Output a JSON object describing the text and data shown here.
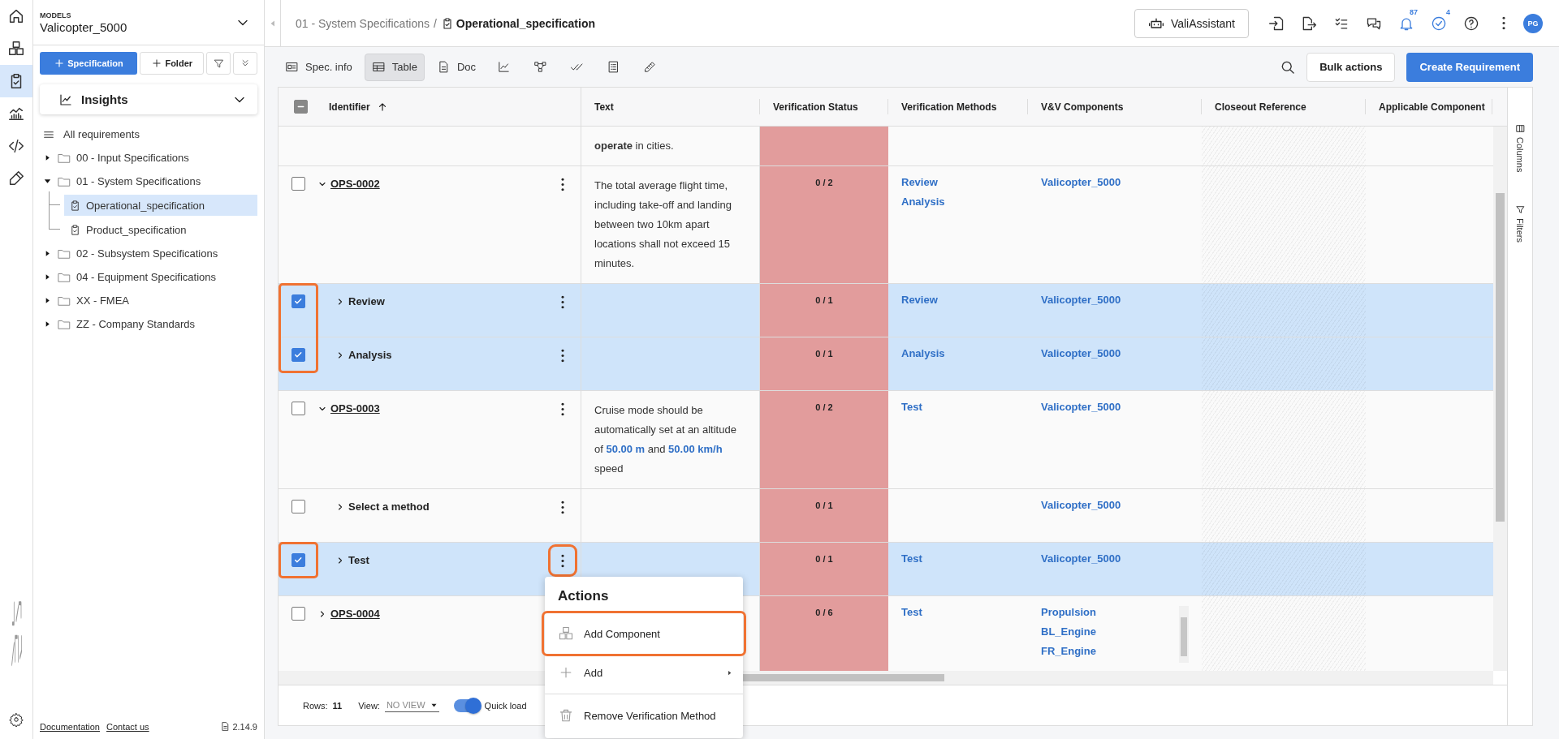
{
  "rail": {
    "items": [
      {
        "selected": false
      },
      {
        "selected": false
      },
      {
        "selected": true
      },
      {
        "selected": false
      },
      {
        "selected": false
      },
      {
        "selected": false
      }
    ]
  },
  "sidebar": {
    "models_label": "MODELS",
    "model": "Valicopter_5000",
    "spec_button": "Specification",
    "folder_button": "Folder",
    "insights": "Insights",
    "tree": {
      "all_label": "All requirements",
      "items": [
        {
          "kind": "folder",
          "label": "00 - Input Specifications",
          "expanded": false
        },
        {
          "kind": "folder",
          "label": "01 - System Specifications",
          "expanded": true,
          "children": [
            {
              "kind": "spec",
              "label": "Operational_specification",
              "selected": true
            },
            {
              "kind": "spec",
              "label": "Product_specification",
              "selected": false
            }
          ]
        },
        {
          "kind": "folder",
          "label": "02 - Subsystem Specifications",
          "expanded": false
        },
        {
          "kind": "folder",
          "label": "04 - Equipment Specifications",
          "expanded": false
        },
        {
          "kind": "folder",
          "label": "XX - FMEA",
          "expanded": false
        },
        {
          "kind": "folder",
          "label": "ZZ - Company Standards",
          "expanded": false
        }
      ]
    },
    "links": [
      "Documentation",
      "Contact us"
    ],
    "version": "2.14.9"
  },
  "header": {
    "breadcrumb_parent": "01 - System Specifications",
    "separator": "/",
    "breadcrumb_current": "Operational_specification",
    "assistant": "ValiAssistant",
    "notifications_badge": "87",
    "tasks_badge": "4",
    "avatar": "PG"
  },
  "toolbar": {
    "tabs": [
      {
        "label": "Spec. info",
        "selected": false
      },
      {
        "label": "Table",
        "selected": true
      },
      {
        "label": "Doc",
        "selected": false
      },
      {
        "selected": false
      },
      {
        "selected": false
      },
      {
        "selected": false
      },
      {
        "selected": false
      },
      {
        "selected": false
      }
    ],
    "bulk": "Bulk actions",
    "create": "Create Requirement"
  },
  "table": {
    "indeterminate": true,
    "columns": [
      {
        "label": "Identifier",
        "sorted_ascending": true
      },
      {
        "label": "Text"
      },
      {
        "label": "Verification Status"
      },
      {
        "label": "Verification Methods"
      },
      {
        "label": "V&V Components"
      },
      {
        "label": "Closeout Reference",
        "readonly": true
      },
      {
        "label": "Applicable Component"
      }
    ],
    "rows": [
      {
        "kind": "continuation",
        "text": [
          {
            "kind": "bold",
            "text": "operate"
          },
          {
            "kind": "plain",
            "text": " in cities."
          }
        ]
      },
      {
        "kind": "requirement",
        "identifier": "OPS-0002",
        "expanded": true,
        "checked": false,
        "text": [
          {
            "kind": "plain",
            "text": "The total average flight time, including take-off and landing between two 10km apart locations shall not exceed 15 minutes."
          }
        ],
        "status": "0 / 2",
        "methods": [
          "Review",
          "Analysis"
        ],
        "components": [
          "Valicopter_5000"
        ]
      },
      {
        "kind": "method",
        "identifier": "Review",
        "expanded": false,
        "checked": true,
        "highlighted": true,
        "status": "0 / 1",
        "methods": [
          "Review"
        ],
        "components": [
          "Valicopter_5000"
        ]
      },
      {
        "kind": "method",
        "identifier": "Analysis",
        "expanded": false,
        "checked": true,
        "highlighted": true,
        "status": "0 / 1",
        "methods": [
          "Analysis"
        ],
        "components": [
          "Valicopter_5000"
        ]
      },
      {
        "kind": "requirement",
        "identifier": "OPS-0003",
        "expanded": true,
        "checked": false,
        "text": [
          {
            "kind": "plain",
            "text": "Cruise mode should be automatically set at an altitude of "
          },
          {
            "kind": "value",
            "text": "50.00 m"
          },
          {
            "kind": "plain",
            "text": " and "
          },
          {
            "kind": "value",
            "text": "50.00 km/h"
          },
          {
            "kind": "plain",
            "text": " speed"
          }
        ],
        "status": "0 / 2",
        "methods": [
          "Test"
        ],
        "components": [
          "Valicopter_5000"
        ]
      },
      {
        "kind": "method",
        "identifier": "Select a method",
        "expanded": false,
        "checked": false,
        "status": "0 / 1",
        "components": [
          "Valicopter_5000"
        ]
      },
      {
        "kind": "method",
        "identifier": "Test",
        "expanded": false,
        "checked": true,
        "highlighted": true,
        "menu_open": true,
        "status": "0 / 1",
        "methods": [
          "Test"
        ],
        "components": [
          "Valicopter_5000"
        ]
      },
      {
        "kind": "requirement",
        "identifier": "OPS-0004",
        "expanded": false,
        "checked": false,
        "status": "0 / 6",
        "methods": [
          "Test"
        ],
        "components": [
          "Propulsion",
          "BL_Engine",
          "FR_Engine"
        ]
      }
    ],
    "footer": {
      "rows_label": "Rows:",
      "rows_count": "11",
      "view_label": "View:",
      "view_value": "NO VIEW",
      "quick_load": {
        "label": "Quick load",
        "on": true
      }
    }
  },
  "side_panel": [
    "Columns",
    "Filters"
  ],
  "menu": {
    "title": "Actions",
    "items": [
      {
        "kind": "item",
        "label": "Add Component",
        "highlighted": true
      },
      {
        "kind": "submenu",
        "label": "Add"
      },
      {
        "kind": "divider"
      },
      {
        "kind": "item",
        "label": "Remove Verification Method"
      }
    ]
  }
}
